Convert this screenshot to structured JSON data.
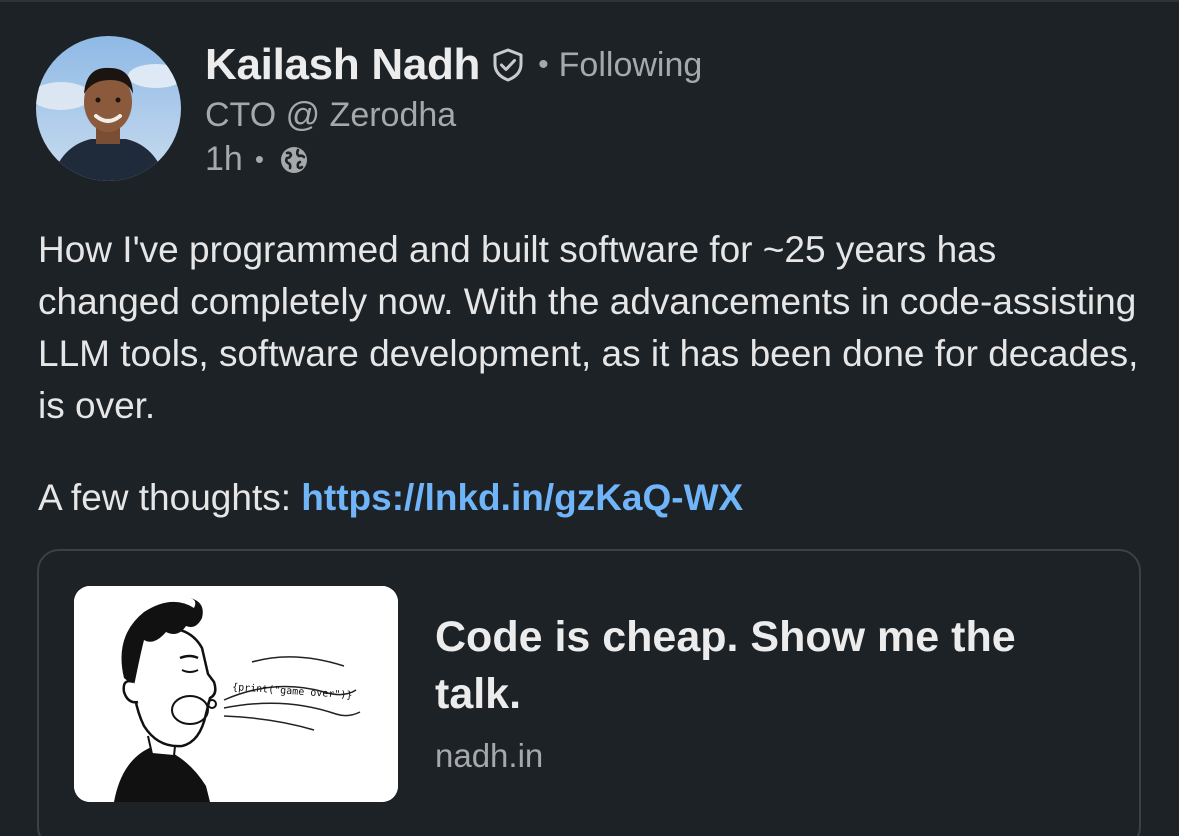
{
  "author": {
    "name": "Kailash Nadh",
    "connection": "Following",
    "headline": "CTO @ Zerodha",
    "posted_ago": "1h",
    "verified_icon": "verified-shield-icon",
    "visibility_icon": "globe-icon"
  },
  "post": {
    "body": "How I've programmed and built software for ~25 years has changed completely now. With the advancements in code-assisting LLM tools, software development, as it has been done for decades, is over.",
    "thoughts_prefix": "A few thoughts: ",
    "link_text": "https://lnkd.in/gzKaQ-WX"
  },
  "preview": {
    "title": "Code is cheap. Show me the talk.",
    "domain": "nadh.in",
    "image_text": "{print(\"game over\")}"
  },
  "colors": {
    "background": "#1d2226",
    "link": "#70b5f9",
    "muted": "#a6a8aa"
  }
}
